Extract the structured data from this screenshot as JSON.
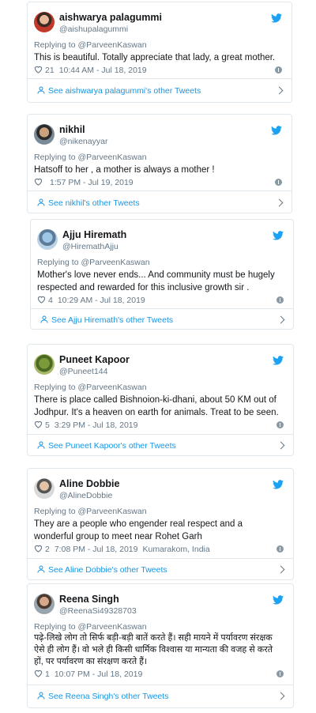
{
  "colors": {
    "link": "#1b95e0",
    "muted": "#657786",
    "text": "#14171a",
    "border": "#e1e8ed",
    "twitter": "#1da1f2"
  },
  "icons": {
    "brand": "twitter-bird-icon",
    "like": "heart-icon",
    "info": "info-icon",
    "profile": "user-icon",
    "next": "chevron-right-icon"
  },
  "tweets": [
    {
      "name": "aishwarya palagummi",
      "handle": "@aishupalagummi",
      "reply": "Replying to @ParveenKaswan",
      "text": "This is beautiful. Totally appreciate that lady, a great mother.",
      "likes": "21",
      "time": "10:44 AM - Jul 18, 2019",
      "location": "",
      "other": "See aishwarya palagummi's other Tweets"
    },
    {
      "name": "nikhil",
      "handle": "@nikenayyar",
      "reply": "Replying to @ParveenKaswan",
      "text": "Hatsoff to her , a mother is always a mother !",
      "likes": "",
      "time": "1:57 PM - Jul 19, 2019",
      "location": "",
      "other": "See nikhil's other Tweets"
    },
    {
      "name": "Ajju Hiremath",
      "handle": "@HiremathAjju",
      "reply": "Replying to @ParveenKaswan",
      "text": "Mother's love never ends... And community must be hugely respected and rewarded for this inclusive growth sir .",
      "likes": "4",
      "time": "10:29 AM - Jul 18, 2019",
      "location": "",
      "other": "See Ajju Hiremath's other Tweets"
    },
    {
      "name": "Puneet Kapoor",
      "handle": "@Puneet144",
      "reply": "Replying to @ParveenKaswan",
      "text": "There is place called Bishnoion-ki-dhani, about 50 KM out of Jodhpur. It's a heaven on earth for animals. Treat to be seen.",
      "likes": "5",
      "time": "3:29 PM - Jul 18, 2019",
      "location": "",
      "other": "See Puneet Kapoor's other Tweets"
    },
    {
      "name": "Aline Dobbie",
      "handle": "@AlineDobbie",
      "reply": "Replying to @ParveenKaswan",
      "text": "They are a people who engender real respect and a wonderful group to meet near Rohet Garh",
      "likes": "2",
      "time": "7:08 PM - Jul 18, 2019",
      "location": "Kumarakom, India",
      "other": "See Aline Dobbie's other Tweets"
    },
    {
      "name": "Reena Singh",
      "handle": "@ReenaSi49328703",
      "reply": "Replying to @ParveenKaswan",
      "text": "पढ़े-लिखे लोग तो सिर्फ बड़ी-बड़ी बातें करते हैं। सही मायने में पर्यावरण संरक्षक ऐसे ही लोग हैं।  वो भले ही किसी धार्मिक विश्वास या मान्यता की वजह से करते हों, पर पर्यावरण का संरक्षण करते हैं।",
      "likes": "1",
      "time": "10:07 PM - Jul 18, 2019",
      "location": "",
      "other": "See Reena Singh's other Tweets"
    }
  ]
}
